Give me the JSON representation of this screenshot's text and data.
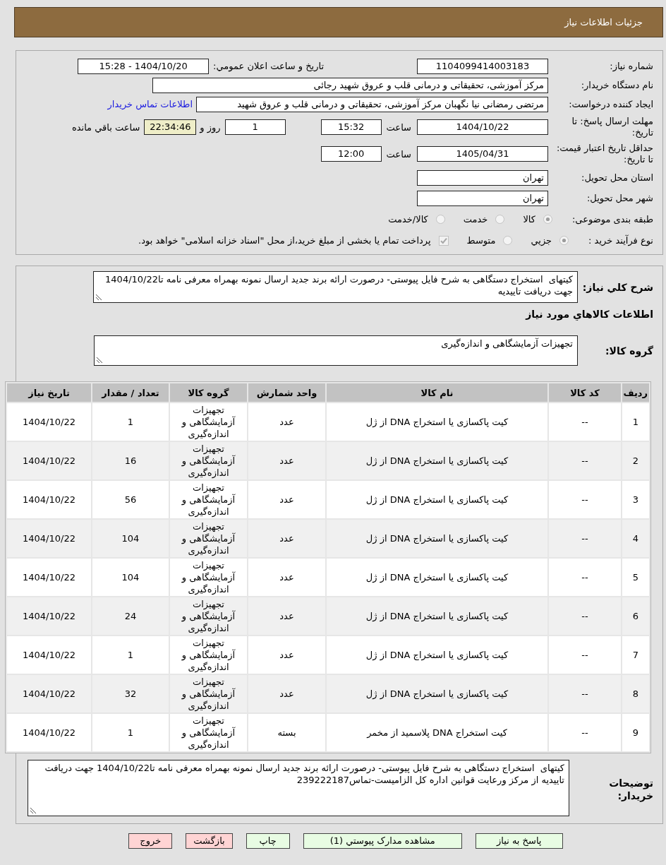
{
  "header": {
    "title": "جزئیات اطلاعات نیاز"
  },
  "details": {
    "need_number": {
      "label": "شماره نیاز:",
      "value": "1104099414003183"
    },
    "announce_datetime": {
      "label": "تاریخ و ساعت اعلان عمومي:",
      "value": "1404/10/20 - 15:28"
    },
    "buyer_org": {
      "label": "نام دستگاه خریدار:",
      "value": "مرکز آموزشی، تحقیقاتی و درمانی قلب و عروق شهید رجائی"
    },
    "requester": {
      "label": "ایجاد کننده درخواست:",
      "value": "مرتضی رمضانی نیا نگهبان مرکز آموزشی، تحقیقاتی و درمانی قلب و عروق شهید",
      "link": "اطلاعات تماس خریدار"
    },
    "response_deadline": {
      "label": "مهلت ارسال پاسخ: تا تاریخ:",
      "date": "1404/10/22",
      "time_label": "ساعت",
      "time": "15:32",
      "days": "1",
      "days_label": "روز و",
      "remaining": "22:34:46",
      "remaining_label": "ساعت باقي مانده"
    },
    "price_validity": {
      "label": "حداقل تاریخ اعتبار قیمت: تا تاریخ:",
      "date": "1405/04/31",
      "time_label": "ساعت",
      "time": "12:00"
    },
    "province": {
      "label": "استان محل تحویل:",
      "value": "تهران"
    },
    "city": {
      "label": "شهر محل تحویل:",
      "value": "تهران"
    },
    "category": {
      "label": "طبقه بندی موضوعی:",
      "options": [
        {
          "label": "کالا",
          "selected": true
        },
        {
          "label": "خدمت",
          "selected": false
        },
        {
          "label": "کالا/خدمت",
          "selected": false
        }
      ]
    },
    "purchase_process": {
      "label": "نوع فرآیند خرید :",
      "options": [
        {
          "label": "جزيي",
          "selected": true
        },
        {
          "label": "متوسط",
          "selected": false
        }
      ],
      "treasury": {
        "label": "پرداخت تمام یا بخشی از مبلغ خرید،از محل \"اسناد خزانه اسلامی\" خواهد بود.",
        "checked": true
      }
    }
  },
  "needs": {
    "summary": {
      "label": "شرح کلي نیاز:",
      "value": "کیتهای  استخراج دستگاهی به شرح فایل پیوستی- درصورت ارائه برند جدید ارسال نمونه بهمراه معرفی نامه تا1404/10/22 جهت دریافت تاییدیه"
    },
    "goods_heading": "اطلاعات کالاهاي مورد نیاز",
    "goods_group": {
      "label": "گروه کالا:",
      "value": "تجهیزات آزمایشگاهی و اندازه‌گیری"
    },
    "table": {
      "columns": [
        "ردیف",
        "کد کالا",
        "نام کالا",
        "واحد شمارش",
        "گروه کالا",
        "تعداد / مقدار",
        "تاریخ نیاز"
      ],
      "rows": [
        [
          "1",
          "--",
          "کیت پاکسازی یا استخراج DNA از ژل",
          "عدد",
          "تجهیزات آزمایشگاهی و اندازه‌گیری",
          "1",
          "1404/10/22"
        ],
        [
          "2",
          "--",
          "کیت پاکسازی یا استخراج DNA از ژل",
          "عدد",
          "تجهیزات آزمایشگاهی و اندازه‌گیری",
          "16",
          "1404/10/22"
        ],
        [
          "3",
          "--",
          "کیت پاکسازی یا استخراج DNA از ژل",
          "عدد",
          "تجهیزات آزمایشگاهی و اندازه‌گیری",
          "56",
          "1404/10/22"
        ],
        [
          "4",
          "--",
          "کیت پاکسازی یا استخراج DNA از ژل",
          "عدد",
          "تجهیزات آزمایشگاهی و اندازه‌گیری",
          "104",
          "1404/10/22"
        ],
        [
          "5",
          "--",
          "کیت پاکسازی یا استخراج DNA از ژل",
          "عدد",
          "تجهیزات آزمایشگاهی و اندازه‌گیری",
          "104",
          "1404/10/22"
        ],
        [
          "6",
          "--",
          "کیت پاکسازی یا استخراج DNA از ژل",
          "عدد",
          "تجهیزات آزمایشگاهی و اندازه‌گیری",
          "24",
          "1404/10/22"
        ],
        [
          "7",
          "--",
          "کیت پاکسازی یا استخراج DNA از ژل",
          "عدد",
          "تجهیزات آزمایشگاهی و اندازه‌گیری",
          "1",
          "1404/10/22"
        ],
        [
          "8",
          "--",
          "کیت پاکسازی یا استخراج DNA از ژل",
          "عدد",
          "تجهیزات آزمایشگاهی و اندازه‌گیری",
          "32",
          "1404/10/22"
        ],
        [
          "9",
          "--",
          "کیت استخراج DNA پلاسمید از مخمر",
          "بسته",
          "تجهیزات آزمایشگاهی و اندازه‌گیری",
          "1",
          "1404/10/22"
        ]
      ]
    },
    "buyer_notes": {
      "label": "توضیحات خریدار:",
      "value": "کیتهای  استخراج دستگاهی به شرح فایل پیوستی- درصورت ارائه برند جدید ارسال نمونه بهمراه معرفی نامه تا1404/10/22 جهت دریافت تاییدیه از مرکز ورعایت قوانین اداره کل الزامیست-تماس239222187"
    }
  },
  "buttons": [
    {
      "label": "پاسخ به نیاز",
      "kind": "action"
    },
    {
      "label": "مشاهده مدارک پیوستي (1)",
      "kind": "action"
    },
    {
      "label": "چاپ",
      "kind": "action"
    },
    {
      "label": "بازگشت",
      "kind": "exit"
    },
    {
      "label": "خروج",
      "kind": "exit"
    }
  ]
}
